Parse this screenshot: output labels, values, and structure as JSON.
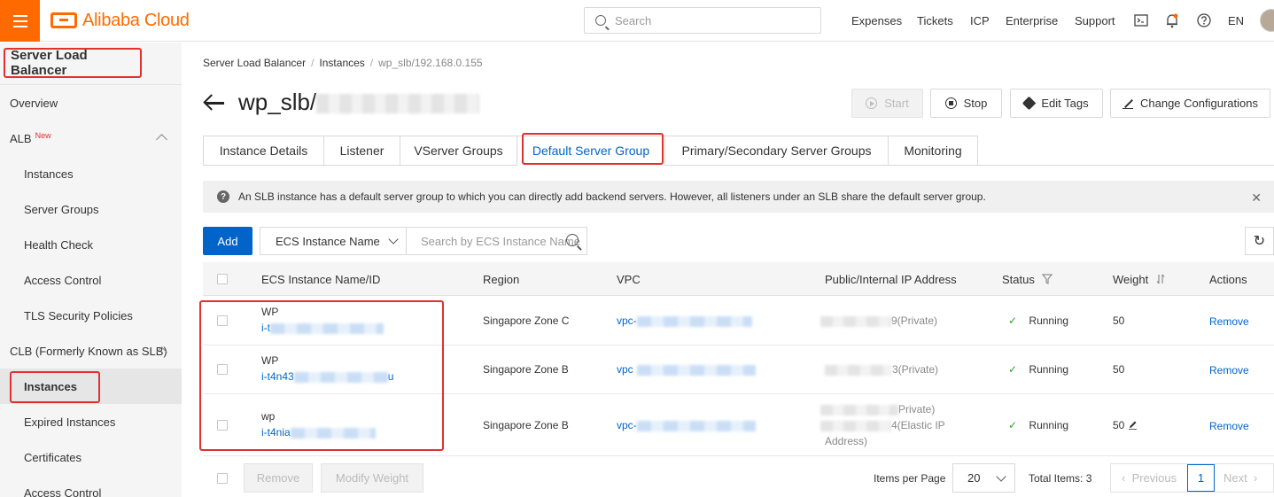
{
  "topbar": {
    "brand": "Alibaba Cloud",
    "search_placeholder": "Search",
    "nav": [
      "Expenses",
      "Tickets",
      "ICP",
      "Enterprise",
      "Support"
    ],
    "lang": "EN",
    "accent": "#ff6a00"
  },
  "sidebar": {
    "title": "Server Load Balancer",
    "overview": "Overview",
    "alb": "ALB",
    "alb_badge": "New",
    "alb_items": [
      "Instances",
      "Server Groups",
      "Health Check",
      "Access Control",
      "TLS Security Policies"
    ],
    "clb": "CLB (Formerly Known as SLB)",
    "clb_items": [
      "Instances",
      "Expired Instances",
      "Certificates",
      "Access Control"
    ]
  },
  "breadcrumb": {
    "items": [
      "Server Load Balancer",
      "Instances"
    ],
    "current": "wp_slb/192.168.0.155"
  },
  "header": {
    "title_prefix": "wp_slb/",
    "buttons": {
      "start": "Start",
      "stop": "Stop",
      "edit_tags": "Edit Tags",
      "change_config": "Change Configurations"
    }
  },
  "tabs": [
    "Instance Details",
    "Listener",
    "VServer Groups",
    "Default Server Group",
    "Primary/Secondary Server Groups",
    "Monitoring"
  ],
  "active_tab": "Default Server Group",
  "notice": "An SLB instance has a default server group to which you can directly add backend servers. However, all listeners under an SLB share the default server group.",
  "toolbar": {
    "add": "Add",
    "filter_select": "ECS Instance Name",
    "search_placeholder": "Search by ECS Instance Name"
  },
  "table": {
    "columns": [
      "ECS Instance Name/ID",
      "Region",
      "VPC",
      "Public/Internal IP Address",
      "Status",
      "Weight",
      "Actions"
    ],
    "rows": [
      {
        "name": "WP",
        "id_prefix": "i-t",
        "region": "Singapore Zone C",
        "vpc_prefix": "vpc-",
        "ip_lines": [
          "9(Private)"
        ],
        "status": "Running",
        "weight": "50",
        "action": "Remove"
      },
      {
        "name": "WP",
        "id_prefix": "i-t4n43",
        "id_suffix": "u",
        "region": "Singapore Zone B",
        "vpc_prefix": "vpc",
        "ip_lines": [
          "3(Private)"
        ],
        "status": "Running",
        "weight": "50",
        "action": "Remove"
      },
      {
        "name": "wp",
        "id_prefix": "i-t4nia",
        "region": "Singapore Zone B",
        "vpc_prefix": "vpc-",
        "ip_lines": [
          "Private)",
          "4(Elastic IP",
          "Address)"
        ],
        "status": "Running",
        "weight": "50",
        "action": "Remove"
      }
    ]
  },
  "footer": {
    "remove": "Remove",
    "modify_weight": "Modify Weight",
    "items_per_page_label": "Items per Page",
    "items_per_page": "20",
    "total": "Total Items: 3",
    "previous": "Previous",
    "page": "1",
    "next": "Next"
  }
}
